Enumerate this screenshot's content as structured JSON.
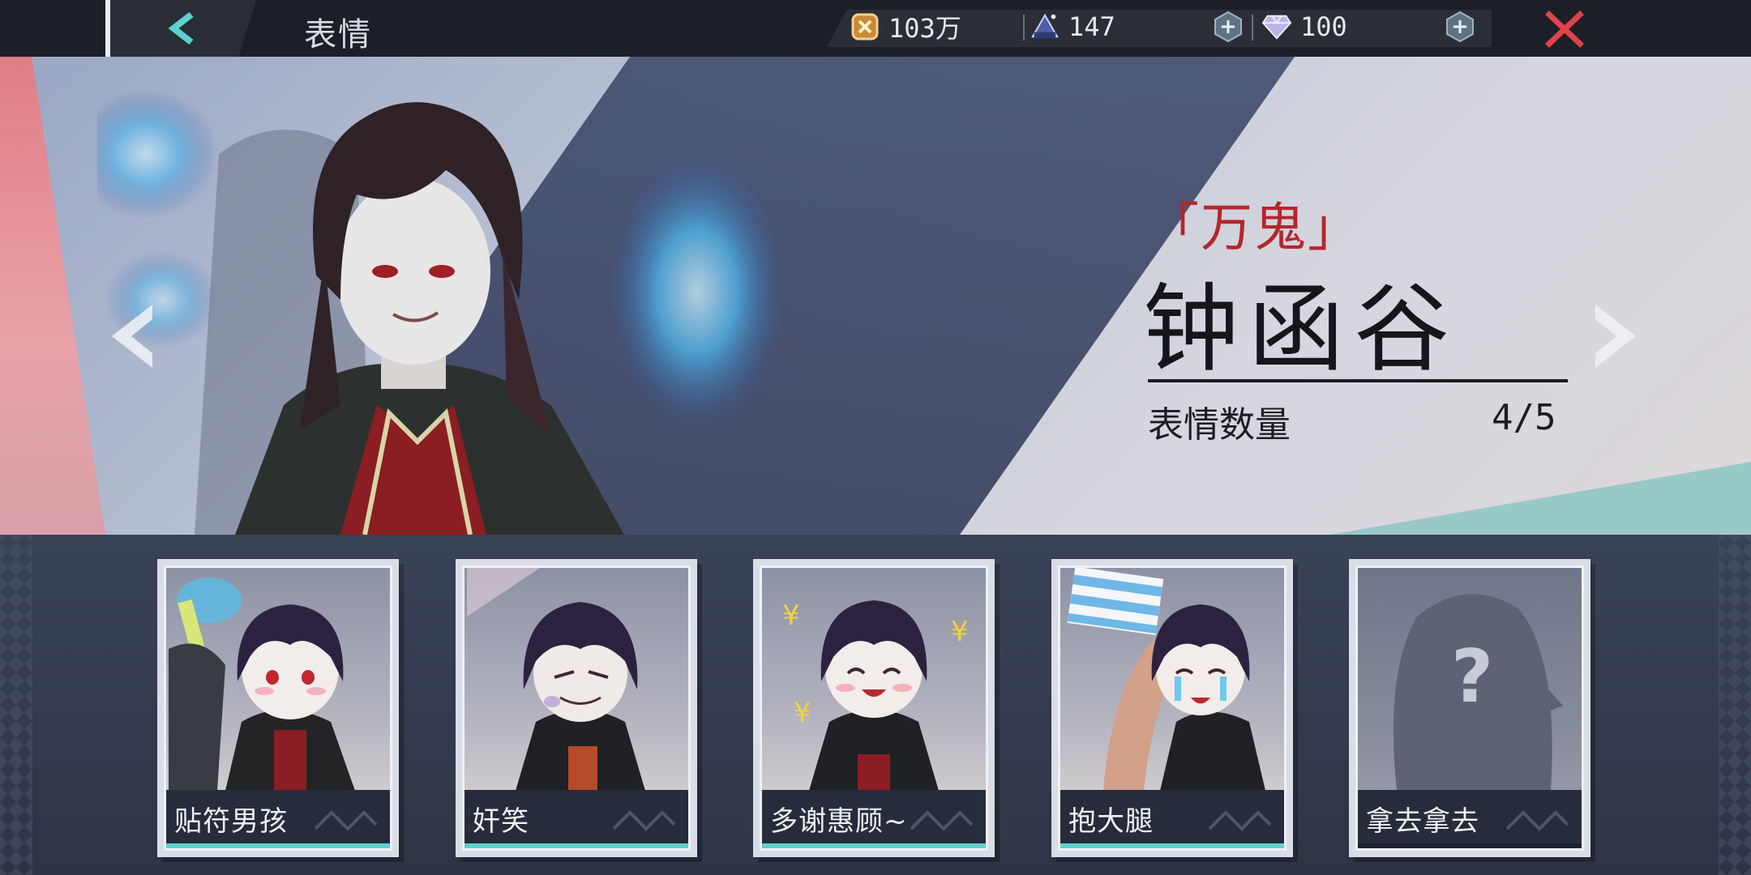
{
  "header": {
    "title": "表情",
    "currencies": [
      {
        "name": "gold",
        "icon": "gold-coin-icon",
        "value": "103万"
      },
      {
        "name": "stamina",
        "icon": "stamina-crystal-icon",
        "value": "147"
      },
      {
        "name": "diamond",
        "icon": "diamond-icon",
        "value": "100"
      }
    ]
  },
  "character": {
    "epithet": "「万鬼」",
    "name": "钟函谷",
    "count_label": "表情数量",
    "count_value": "4/5"
  },
  "expressions": [
    {
      "label": "贴符男孩",
      "unlocked": true
    },
    {
      "label": "奸笑",
      "unlocked": true
    },
    {
      "label": "多谢惠顾~",
      "unlocked": true
    },
    {
      "label": "抱大腿",
      "unlocked": true
    },
    {
      "label": "拿去拿去",
      "unlocked": false
    }
  ],
  "colors": {
    "accent_teal": "#5fd0cf",
    "epithet_red": "#b5262c",
    "close_red": "#e0434a"
  }
}
